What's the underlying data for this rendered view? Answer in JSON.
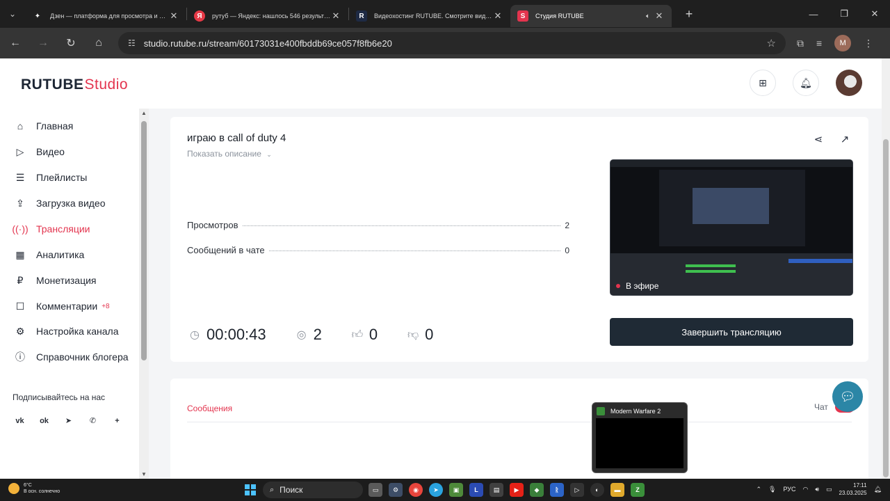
{
  "browser": {
    "tabs": [
      {
        "title": "Дзен — платформа для просмотра и создани",
        "favicon": "star-icon",
        "color": "#1f1f1f"
      },
      {
        "title": "рутуб — Яндекс: нашлось 546 результатов",
        "favicon": "yandex-icon",
        "color": "#e63946"
      },
      {
        "title": "Видеохостинг RUTUBE. Смотрите видео онла",
        "favicon": "rutube-icon",
        "color": "#1e2a44"
      },
      {
        "title": "Студия RUTUBE",
        "favicon": "rutube-studio-icon",
        "color": "#e3344e",
        "active": true
      }
    ],
    "url": "studio.rutube.ru/stream/60173031e400fbddb69ce057f8fb6e20",
    "profile_letter": "M"
  },
  "header": {
    "logo_main": "RUTUBE",
    "logo_studio": "Studio"
  },
  "sidebar": {
    "items": [
      {
        "label": "Главная",
        "icon": "home-icon"
      },
      {
        "label": "Видео",
        "icon": "video-icon"
      },
      {
        "label": "Плейлисты",
        "icon": "playlist-icon"
      },
      {
        "label": "Загрузка видео",
        "icon": "upload-icon"
      },
      {
        "label": "Трансляции",
        "icon": "broadcast-icon",
        "active": true
      },
      {
        "label": "Аналитика",
        "icon": "analytics-icon"
      },
      {
        "label": "Монетизация",
        "icon": "ruble-icon"
      },
      {
        "label": "Комментарии",
        "icon": "comment-icon",
        "badge": "+8"
      },
      {
        "label": "Настройка канала",
        "icon": "gear-icon"
      },
      {
        "label": "Справочник блогера",
        "icon": "help-book-icon"
      }
    ],
    "follow_label": "Подписывайтесь на нас",
    "socials": [
      "vk-icon",
      "ok-icon",
      "telegram-icon",
      "viber-icon",
      "plus-icon"
    ]
  },
  "stream": {
    "title": "играю в call of duty 4",
    "show_description": "Показать описание",
    "stats": [
      {
        "label": "Просмотров",
        "value": "2"
      },
      {
        "label": "Сообщений в чате",
        "value": "0"
      }
    ],
    "duration": "00:00:43",
    "viewers": "2",
    "likes": "0",
    "dislikes": "0",
    "live_label": "В эфире",
    "end_button": "Завершить трансляцию"
  },
  "chat": {
    "tab_label": "Сообщения",
    "toggle_label": "Чат"
  },
  "popup": {
    "title": "Modern Warfare 2"
  },
  "taskbar": {
    "weather_temp": "6°C",
    "weather_desc": "В осн. солнечно",
    "search_label": "Поиск",
    "lang": "РУС",
    "time": "17:11",
    "date": "23.03.2025"
  }
}
